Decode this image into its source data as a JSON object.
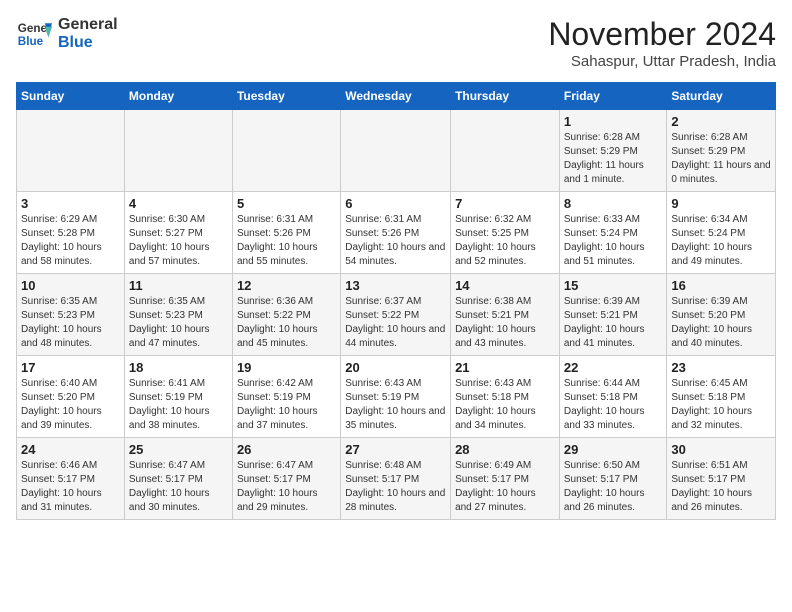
{
  "header": {
    "logo_line1": "General",
    "logo_line2": "Blue",
    "month_title": "November 2024",
    "subtitle": "Sahaspur, Uttar Pradesh, India"
  },
  "weekdays": [
    "Sunday",
    "Monday",
    "Tuesday",
    "Wednesday",
    "Thursday",
    "Friday",
    "Saturday"
  ],
  "rows": [
    [
      {
        "day": "",
        "info": ""
      },
      {
        "day": "",
        "info": ""
      },
      {
        "day": "",
        "info": ""
      },
      {
        "day": "",
        "info": ""
      },
      {
        "day": "",
        "info": ""
      },
      {
        "day": "1",
        "info": "Sunrise: 6:28 AM\nSunset: 5:29 PM\nDaylight: 11 hours and 1 minute."
      },
      {
        "day": "2",
        "info": "Sunrise: 6:28 AM\nSunset: 5:29 PM\nDaylight: 11 hours and 0 minutes."
      }
    ],
    [
      {
        "day": "3",
        "info": "Sunrise: 6:29 AM\nSunset: 5:28 PM\nDaylight: 10 hours and 58 minutes."
      },
      {
        "day": "4",
        "info": "Sunrise: 6:30 AM\nSunset: 5:27 PM\nDaylight: 10 hours and 57 minutes."
      },
      {
        "day": "5",
        "info": "Sunrise: 6:31 AM\nSunset: 5:26 PM\nDaylight: 10 hours and 55 minutes."
      },
      {
        "day": "6",
        "info": "Sunrise: 6:31 AM\nSunset: 5:26 PM\nDaylight: 10 hours and 54 minutes."
      },
      {
        "day": "7",
        "info": "Sunrise: 6:32 AM\nSunset: 5:25 PM\nDaylight: 10 hours and 52 minutes."
      },
      {
        "day": "8",
        "info": "Sunrise: 6:33 AM\nSunset: 5:24 PM\nDaylight: 10 hours and 51 minutes."
      },
      {
        "day": "9",
        "info": "Sunrise: 6:34 AM\nSunset: 5:24 PM\nDaylight: 10 hours and 49 minutes."
      }
    ],
    [
      {
        "day": "10",
        "info": "Sunrise: 6:35 AM\nSunset: 5:23 PM\nDaylight: 10 hours and 48 minutes."
      },
      {
        "day": "11",
        "info": "Sunrise: 6:35 AM\nSunset: 5:23 PM\nDaylight: 10 hours and 47 minutes."
      },
      {
        "day": "12",
        "info": "Sunrise: 6:36 AM\nSunset: 5:22 PM\nDaylight: 10 hours and 45 minutes."
      },
      {
        "day": "13",
        "info": "Sunrise: 6:37 AM\nSunset: 5:22 PM\nDaylight: 10 hours and 44 minutes."
      },
      {
        "day": "14",
        "info": "Sunrise: 6:38 AM\nSunset: 5:21 PM\nDaylight: 10 hours and 43 minutes."
      },
      {
        "day": "15",
        "info": "Sunrise: 6:39 AM\nSunset: 5:21 PM\nDaylight: 10 hours and 41 minutes."
      },
      {
        "day": "16",
        "info": "Sunrise: 6:39 AM\nSunset: 5:20 PM\nDaylight: 10 hours and 40 minutes."
      }
    ],
    [
      {
        "day": "17",
        "info": "Sunrise: 6:40 AM\nSunset: 5:20 PM\nDaylight: 10 hours and 39 minutes."
      },
      {
        "day": "18",
        "info": "Sunrise: 6:41 AM\nSunset: 5:19 PM\nDaylight: 10 hours and 38 minutes."
      },
      {
        "day": "19",
        "info": "Sunrise: 6:42 AM\nSunset: 5:19 PM\nDaylight: 10 hours and 37 minutes."
      },
      {
        "day": "20",
        "info": "Sunrise: 6:43 AM\nSunset: 5:19 PM\nDaylight: 10 hours and 35 minutes."
      },
      {
        "day": "21",
        "info": "Sunrise: 6:43 AM\nSunset: 5:18 PM\nDaylight: 10 hours and 34 minutes."
      },
      {
        "day": "22",
        "info": "Sunrise: 6:44 AM\nSunset: 5:18 PM\nDaylight: 10 hours and 33 minutes."
      },
      {
        "day": "23",
        "info": "Sunrise: 6:45 AM\nSunset: 5:18 PM\nDaylight: 10 hours and 32 minutes."
      }
    ],
    [
      {
        "day": "24",
        "info": "Sunrise: 6:46 AM\nSunset: 5:17 PM\nDaylight: 10 hours and 31 minutes."
      },
      {
        "day": "25",
        "info": "Sunrise: 6:47 AM\nSunset: 5:17 PM\nDaylight: 10 hours and 30 minutes."
      },
      {
        "day": "26",
        "info": "Sunrise: 6:47 AM\nSunset: 5:17 PM\nDaylight: 10 hours and 29 minutes."
      },
      {
        "day": "27",
        "info": "Sunrise: 6:48 AM\nSunset: 5:17 PM\nDaylight: 10 hours and 28 minutes."
      },
      {
        "day": "28",
        "info": "Sunrise: 6:49 AM\nSunset: 5:17 PM\nDaylight: 10 hours and 27 minutes."
      },
      {
        "day": "29",
        "info": "Sunrise: 6:50 AM\nSunset: 5:17 PM\nDaylight: 10 hours and 26 minutes."
      },
      {
        "day": "30",
        "info": "Sunrise: 6:51 AM\nSunset: 5:17 PM\nDaylight: 10 hours and 26 minutes."
      }
    ]
  ]
}
